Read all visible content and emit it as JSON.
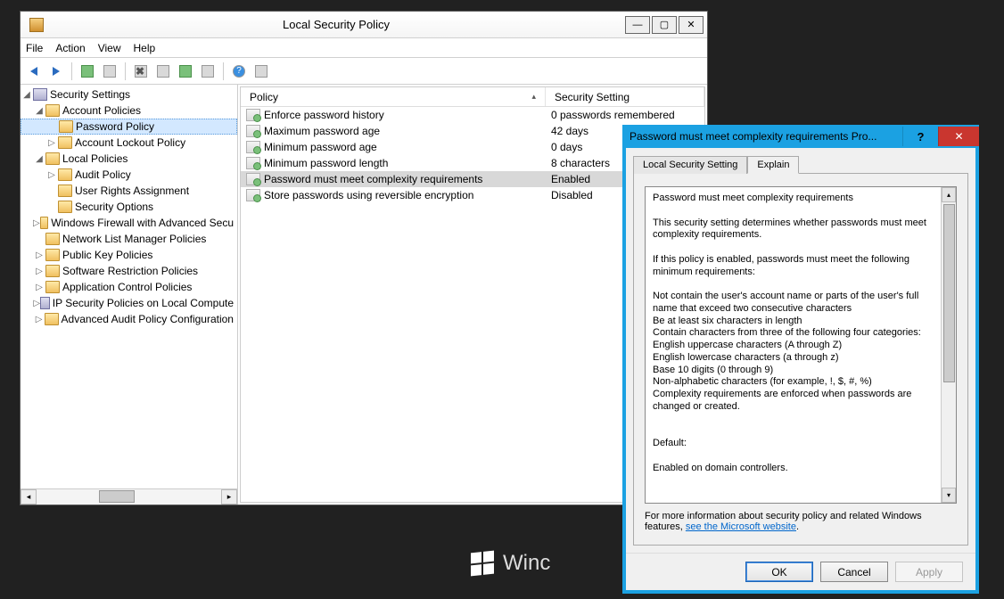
{
  "mainWindow": {
    "title": "Local Security Policy",
    "menus": [
      "File",
      "Action",
      "View",
      "Help"
    ]
  },
  "tree": {
    "root": "Security Settings",
    "nodes": [
      {
        "label": "Account Policies",
        "children": [
          {
            "label": "Password Policy",
            "selected": true
          },
          {
            "label": "Account Lockout Policy",
            "expander": "▷"
          }
        ],
        "expander": "◢"
      },
      {
        "label": "Local Policies",
        "children": [
          {
            "label": "Audit Policy",
            "expander": "▷"
          },
          {
            "label": "User Rights Assignment"
          },
          {
            "label": "Security Options"
          }
        ],
        "expander": "◢"
      },
      {
        "label": "Windows Firewall with Advanced Secu",
        "expander": "▷"
      },
      {
        "label": "Network List Manager Policies"
      },
      {
        "label": "Public Key Policies",
        "expander": "▷"
      },
      {
        "label": "Software Restriction Policies",
        "expander": "▷"
      },
      {
        "label": "Application Control Policies",
        "expander": "▷"
      },
      {
        "label": "IP Security Policies on Local Compute",
        "expander": "▷"
      },
      {
        "label": "Advanced Audit Policy Configuration",
        "expander": "▷"
      }
    ]
  },
  "list": {
    "cols": [
      "Policy",
      "Security Setting"
    ],
    "rows": [
      {
        "policy": "Enforce password history",
        "setting": "0 passwords remembered"
      },
      {
        "policy": "Maximum password age",
        "setting": "42 days"
      },
      {
        "policy": "Minimum password age",
        "setting": "0 days"
      },
      {
        "policy": "Minimum password length",
        "setting": "8 characters"
      },
      {
        "policy": "Password must meet complexity requirements",
        "setting": "Enabled",
        "selected": true
      },
      {
        "policy": "Store passwords using reversible encryption",
        "setting": "Disabled"
      }
    ]
  },
  "dialog": {
    "title": "Password must meet complexity requirements Pro...",
    "tabs": [
      "Local Security Setting",
      "Explain"
    ],
    "activeTab": 1,
    "explain": "Password must meet complexity requirements\n\nThis security setting determines whether passwords must meet complexity requirements.\n\nIf this policy is enabled, passwords must meet the following minimum requirements:\n\nNot contain the user's account name or parts of the user's full name that exceed two consecutive characters\nBe at least six characters in length\nContain characters from three of the following four categories:\nEnglish uppercase characters (A through Z)\nEnglish lowercase characters (a through z)\nBase 10 digits (0 through 9)\nNon-alphabetic characters (for example, !, $, #, %)\nComplexity requirements are enforced when passwords are changed or created.\n\n\nDefault:\n\nEnabled on domain controllers.",
    "footer_pre": "For more information about security policy and related Windows features, ",
    "footer_link": "see the Microsoft website",
    "buttons": {
      "ok": "OK",
      "cancel": "Cancel",
      "apply": "Apply"
    }
  },
  "watermark": "Winc"
}
